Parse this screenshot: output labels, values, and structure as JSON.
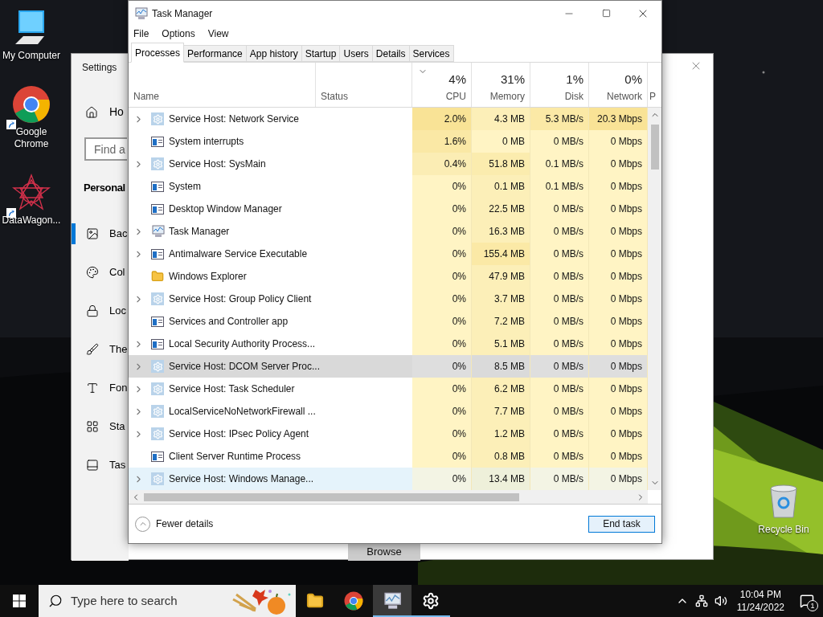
{
  "desktop_icons": [
    {
      "label": "My Computer",
      "kind": "computer",
      "shortcut": false
    },
    {
      "label": "Google Chrome",
      "kind": "chrome",
      "shortcut": true
    },
    {
      "label": "DataWagon...",
      "kind": "star",
      "shortcut": true
    }
  ],
  "recycle_bin": {
    "label": "Recycle Bin"
  },
  "settings_window": {
    "title": "Settings",
    "home": "Ho",
    "search_placeholder": "Find a",
    "section": "Personal",
    "browse_button": "Browse",
    "nav": [
      {
        "label": "Bac",
        "kind": "background",
        "selected": true
      },
      {
        "label": "Col",
        "kind": "colors",
        "selected": false
      },
      {
        "label": "Loc",
        "kind": "lock",
        "selected": false
      },
      {
        "label": "The",
        "kind": "themes",
        "selected": false
      },
      {
        "label": "Fon",
        "kind": "fonts",
        "selected": false
      },
      {
        "label": "Sta",
        "kind": "start",
        "selected": false
      },
      {
        "label": "Tas",
        "kind": "taskbar",
        "selected": false
      }
    ]
  },
  "task_manager": {
    "title": "Task Manager",
    "menu": [
      "File",
      "Options",
      "View"
    ],
    "tabs": [
      {
        "label": "Processes",
        "selected": true
      },
      {
        "label": "Performance",
        "selected": false
      },
      {
        "label": "App history",
        "selected": false
      },
      {
        "label": "Startup",
        "selected": false
      },
      {
        "label": "Users",
        "selected": false
      },
      {
        "label": "Details",
        "selected": false
      },
      {
        "label": "Services",
        "selected": false
      }
    ],
    "name_header": "Name",
    "status_header": "Status",
    "columns": [
      {
        "label": "CPU",
        "usage": "4%"
      },
      {
        "label": "Memory",
        "usage": "31%"
      },
      {
        "label": "Disk",
        "usage": "1%"
      },
      {
        "label": "Network",
        "usage": "0%"
      },
      {
        "label": "P"
      }
    ],
    "rows": [
      {
        "name": "Service Host: Network Service",
        "status": "",
        "kind": "gear",
        "expandable": true,
        "selected": false,
        "hovered": false,
        "cells": [
          {
            "text": "2.0%",
            "color": "#f9e396"
          },
          {
            "text": "4.3 MB",
            "color": "#fcefb8"
          },
          {
            "text": "5.3 MB/s",
            "color": "#fbe9a6"
          },
          {
            "text": "20.3 Mbps",
            "color": "#f9e396"
          }
        ]
      },
      {
        "name": "System interrupts",
        "status": "",
        "kind": "window",
        "expandable": false,
        "selected": false,
        "hovered": false,
        "cells": [
          {
            "text": "1.6%",
            "color": "#fae8a5"
          },
          {
            "text": "0 MB",
            "color": "#fff4c4"
          },
          {
            "text": "0 MB/s",
            "color": "#fff4c4"
          },
          {
            "text": "0 Mbps",
            "color": "#fff4c4"
          }
        ]
      },
      {
        "name": "Service Host: SysMain",
        "status": "",
        "kind": "gear",
        "expandable": true,
        "selected": false,
        "hovered": false,
        "cells": [
          {
            "text": "0.4%",
            "color": "#fbedb4"
          },
          {
            "text": "51.8 MB",
            "color": "#fbecae"
          },
          {
            "text": "0.1 MB/s",
            "color": "#fff4c4"
          },
          {
            "text": "0 Mbps",
            "color": "#fff4c4"
          }
        ]
      },
      {
        "name": "System",
        "status": "",
        "kind": "window",
        "expandable": false,
        "selected": false,
        "hovered": false,
        "cells": [
          {
            "text": "0%",
            "color": "#fff4c4"
          },
          {
            "text": "0.1 MB",
            "color": "#fcefb8"
          },
          {
            "text": "0.1 MB/s",
            "color": "#fff4c4"
          },
          {
            "text": "0 Mbps",
            "color": "#fff4c4"
          }
        ]
      },
      {
        "name": "Desktop Window Manager",
        "status": "",
        "kind": "window",
        "expandable": false,
        "selected": false,
        "hovered": false,
        "cells": [
          {
            "text": "0%",
            "color": "#fff4c4"
          },
          {
            "text": "22.5 MB",
            "color": "#fcefb8"
          },
          {
            "text": "0 MB/s",
            "color": "#fff4c4"
          },
          {
            "text": "0 Mbps",
            "color": "#fff4c4"
          }
        ]
      },
      {
        "name": "Task Manager",
        "status": "",
        "kind": "monitor",
        "expandable": true,
        "selected": false,
        "hovered": false,
        "cells": [
          {
            "text": "0%",
            "color": "#fff4c4"
          },
          {
            "text": "16.3 MB",
            "color": "#fcefb8"
          },
          {
            "text": "0 MB/s",
            "color": "#fff4c4"
          },
          {
            "text": "0 Mbps",
            "color": "#fff4c4"
          }
        ]
      },
      {
        "name": "Antimalware Service Executable",
        "status": "",
        "kind": "window",
        "expandable": true,
        "selected": false,
        "hovered": false,
        "cells": [
          {
            "text": "0%",
            "color": "#fff4c4"
          },
          {
            "text": "155.4 MB",
            "color": "#fbe9a6"
          },
          {
            "text": "0 MB/s",
            "color": "#fff4c4"
          },
          {
            "text": "0 Mbps",
            "color": "#fff4c4"
          }
        ]
      },
      {
        "name": "Windows Explorer",
        "status": "",
        "kind": "folder",
        "expandable": false,
        "selected": false,
        "hovered": false,
        "cells": [
          {
            "text": "0%",
            "color": "#fff4c4"
          },
          {
            "text": "47.9 MB",
            "color": "#fcefb8"
          },
          {
            "text": "0 MB/s",
            "color": "#fff4c4"
          },
          {
            "text": "0 Mbps",
            "color": "#fff4c4"
          }
        ]
      },
      {
        "name": "Service Host: Group Policy Client",
        "status": "",
        "kind": "gear",
        "expandable": true,
        "selected": false,
        "hovered": false,
        "cells": [
          {
            "text": "0%",
            "color": "#fff4c4"
          },
          {
            "text": "3.7 MB",
            "color": "#fcefb8"
          },
          {
            "text": "0 MB/s",
            "color": "#fff4c4"
          },
          {
            "text": "0 Mbps",
            "color": "#fff4c4"
          }
        ]
      },
      {
        "name": "Services and Controller app",
        "status": "",
        "kind": "window",
        "expandable": false,
        "selected": false,
        "hovered": false,
        "cells": [
          {
            "text": "0%",
            "color": "#fff4c4"
          },
          {
            "text": "7.2 MB",
            "color": "#fcefb8"
          },
          {
            "text": "0 MB/s",
            "color": "#fff4c4"
          },
          {
            "text": "0 Mbps",
            "color": "#fff4c4"
          }
        ]
      },
      {
        "name": "Local Security Authority Process...",
        "status": "",
        "kind": "window",
        "expandable": true,
        "selected": false,
        "hovered": false,
        "cells": [
          {
            "text": "0%",
            "color": "#fff4c4"
          },
          {
            "text": "5.1 MB",
            "color": "#fcefb8"
          },
          {
            "text": "0 MB/s",
            "color": "#fff4c4"
          },
          {
            "text": "0 Mbps",
            "color": "#fff4c4"
          }
        ]
      },
      {
        "name": "Service Host: DCOM Server Proc...",
        "status": "",
        "kind": "gear",
        "expandable": true,
        "selected": true,
        "hovered": false,
        "cells": [
          {
            "text": "0%",
            "color": "#dedede"
          },
          {
            "text": "8.5 MB",
            "color": "#dadada"
          },
          {
            "text": "0 MB/s",
            "color": "#dedede"
          },
          {
            "text": "0 Mbps",
            "color": "#dedede"
          }
        ]
      },
      {
        "name": "Service Host: Task Scheduler",
        "status": "",
        "kind": "gear",
        "expandable": true,
        "selected": false,
        "hovered": false,
        "cells": [
          {
            "text": "0%",
            "color": "#fff4c4"
          },
          {
            "text": "6.2 MB",
            "color": "#fcefb8"
          },
          {
            "text": "0 MB/s",
            "color": "#fff4c4"
          },
          {
            "text": "0 Mbps",
            "color": "#fff4c4"
          }
        ]
      },
      {
        "name": "LocalServiceNoNetworkFirewall ...",
        "status": "",
        "kind": "gear",
        "expandable": true,
        "selected": false,
        "hovered": false,
        "cells": [
          {
            "text": "0%",
            "color": "#fff4c4"
          },
          {
            "text": "7.7 MB",
            "color": "#fcefb8"
          },
          {
            "text": "0 MB/s",
            "color": "#fff4c4"
          },
          {
            "text": "0 Mbps",
            "color": "#fff4c4"
          }
        ]
      },
      {
        "name": "Service Host: IPsec Policy Agent",
        "status": "",
        "kind": "gear",
        "expandable": true,
        "selected": false,
        "hovered": false,
        "cells": [
          {
            "text": "0%",
            "color": "#fff4c4"
          },
          {
            "text": "1.2 MB",
            "color": "#fcefb8"
          },
          {
            "text": "0 MB/s",
            "color": "#fff4c4"
          },
          {
            "text": "0 Mbps",
            "color": "#fff4c4"
          }
        ]
      },
      {
        "name": "Client Server Runtime Process",
        "status": "",
        "kind": "window",
        "expandable": false,
        "selected": false,
        "hovered": false,
        "cells": [
          {
            "text": "0%",
            "color": "#fff4c4"
          },
          {
            "text": "0.8 MB",
            "color": "#fcefb8"
          },
          {
            "text": "0 MB/s",
            "color": "#fff4c4"
          },
          {
            "text": "0 Mbps",
            "color": "#fff4c4"
          }
        ]
      },
      {
        "name": "Service Host: Windows Manage...",
        "status": "",
        "kind": "gear",
        "expandable": true,
        "selected": false,
        "hovered": true,
        "cells": [
          {
            "text": "0%",
            "color": "#f3f4e4"
          },
          {
            "text": "13.4 MB",
            "color": "#eef0da"
          },
          {
            "text": "0 MB/s",
            "color": "#f3f4e4"
          },
          {
            "text": "0 Mbps",
            "color": "#f3f4e4"
          }
        ]
      }
    ],
    "fewer_details": "Fewer details",
    "end_task": "End task"
  },
  "taskbar": {
    "search_placeholder": "Type here to search",
    "apps": [
      {
        "kind": "explorer",
        "active": false,
        "running": false
      },
      {
        "kind": "chrome",
        "active": false,
        "running": false
      },
      {
        "kind": "taskmgr",
        "active": true,
        "running": true
      },
      {
        "kind": "settings",
        "active": false,
        "running": true
      }
    ],
    "time": "10:04 PM",
    "date": "11/24/2022",
    "notifications": "1"
  }
}
